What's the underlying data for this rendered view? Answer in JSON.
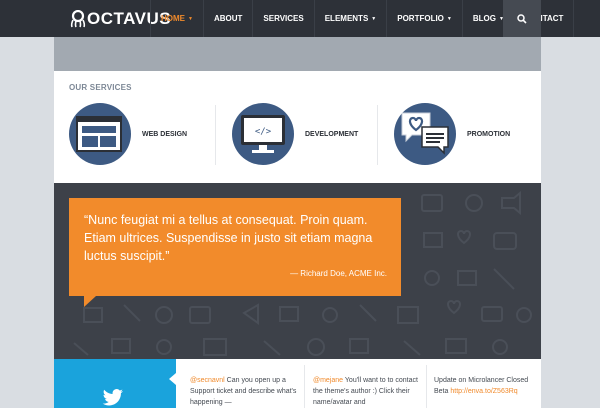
{
  "header": {
    "logo_text": "OCTAVUS",
    "nav": [
      {
        "label": "HOME",
        "active": true,
        "caret": true
      },
      {
        "label": "ABOUT",
        "active": false,
        "caret": false
      },
      {
        "label": "SERVICES",
        "active": false,
        "caret": false
      },
      {
        "label": "ELEMENTS",
        "active": false,
        "caret": true
      },
      {
        "label": "PORTFOLIO",
        "active": false,
        "caret": true
      },
      {
        "label": "BLOG",
        "active": false,
        "caret": true
      },
      {
        "label": "CONTACT",
        "active": false,
        "caret": false
      }
    ],
    "search_icon": "search-icon"
  },
  "services": {
    "title": "OUR SERVICES",
    "items": [
      {
        "label": "WEB DESIGN",
        "icon": "web-layout-icon"
      },
      {
        "label": "DEVELOPMENT",
        "icon": "code-monitor-icon"
      },
      {
        "label": "PROMOTION",
        "icon": "chat-heart-icon"
      }
    ]
  },
  "testimonial": {
    "quote": "“Nunc feugiat mi a tellus at consequat. Proin quam. Etiam ultrices. Suspendisse in justo sit etiam magna luctus suscipit.”",
    "author": "— Richard Doe, ACME Inc."
  },
  "tweets": [
    {
      "handle": "@secnavnl",
      "text": " Can you open up a Support ticket and describe what's happening —"
    },
    {
      "handle": "@mejane",
      "text": " You'll want to to contact the theme's author :) Click their name/avatar and"
    },
    {
      "handle": "",
      "text": "Update on Microlancer Closed Beta ",
      "link": "http://enva.to/Z563Rq"
    }
  ],
  "colors": {
    "nav_bg": "#2d3138",
    "accent": "#f08a2c",
    "service_circle": "#3d5a83",
    "quote_bg": "#f28b2b",
    "dark_section": "#3d4149",
    "twitter_blue": "#1aa3dc"
  }
}
